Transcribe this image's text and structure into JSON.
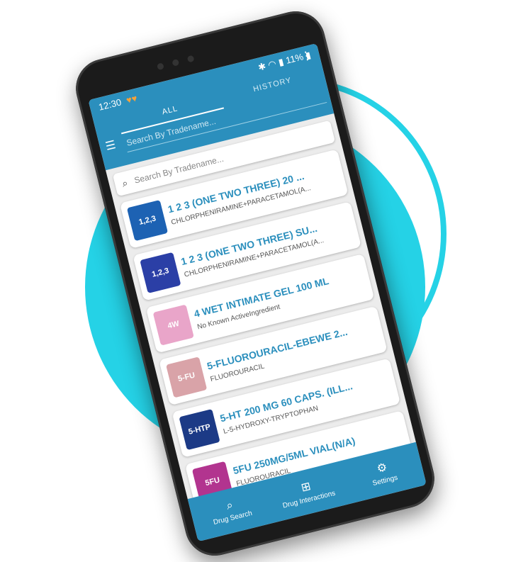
{
  "status": {
    "time": "12:30",
    "hearts": "♥♥",
    "right": "✱ ◠ ▮ 11% ▮"
  },
  "tabs": [
    {
      "label": "ALL"
    },
    {
      "label": "HISTORY"
    }
  ],
  "menu_icon": "more-vert-icon",
  "search": {
    "placeholder": "Search By Tradename..."
  },
  "list_items": [
    {
      "title": "1 2 3 (ONE TWO THREE) 20 ...",
      "subtitle": "CHLORPHENIRAMINE+PARACETAMOL(A...",
      "thumb_text": "1,2,3",
      "thumb_color": "#1d62b3"
    },
    {
      "title": "1 2 3 (ONE TWO THREE) SU...",
      "subtitle": "CHLORPHENIRAMINE+PARACETAMOL(A...",
      "thumb_text": "1,2,3",
      "thumb_color": "#2b3fa6"
    },
    {
      "title": "4 WET INTIMATE GEL 100 ML",
      "subtitle": "No Known ActiveIngredient",
      "thumb_text": "4W",
      "thumb_color": "#e9a5c9"
    },
    {
      "title": "5-FLUOROURACIL-EBEWE 2...",
      "subtitle": "FLUOROURACIL",
      "thumb_text": "5-FU",
      "thumb_color": "#d9a3a8"
    },
    {
      "title": "5-HT 200 MG 60 CAPS. (ILL...",
      "subtitle": "L-5-HYDROXY-TRYPTOPHAN",
      "thumb_text": "5-HTP",
      "thumb_color": "#1c3a86"
    },
    {
      "title": "5FU 250MG/5ML VIAL(N/A)",
      "subtitle": "FLUOROURACIL",
      "thumb_text": "5FU",
      "thumb_color": "#b2348f"
    }
  ],
  "bottom_nav": [
    {
      "label": "Drug Search",
      "icon": "search-icon"
    },
    {
      "label": "Drug Interactions",
      "icon": "medical-plus-icon"
    },
    {
      "label": "Settings",
      "icon": "gear-icon"
    }
  ],
  "colors": {
    "primary": "#2b8fbd",
    "background_circle": "#25d2e6",
    "card_title": "#2b8fbd"
  }
}
